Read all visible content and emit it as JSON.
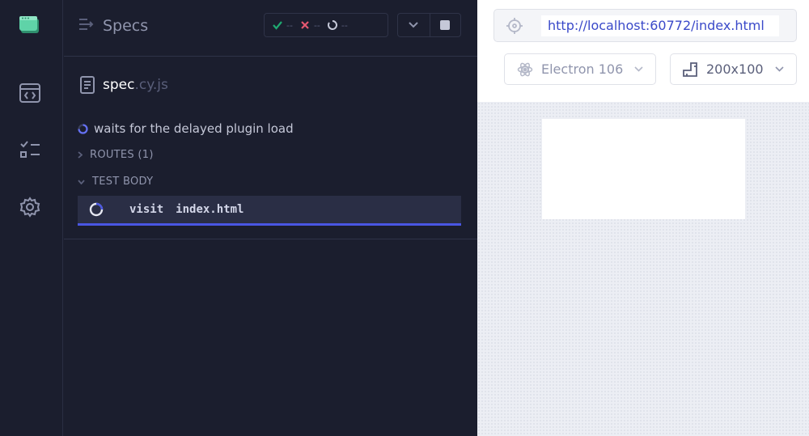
{
  "reporter": {
    "header": {
      "specs_label": "Specs",
      "stats": {
        "passed": "--",
        "failed": "--",
        "pending": "--"
      }
    },
    "spec": {
      "name": "spec",
      "ext": ".cy.js"
    },
    "test": {
      "title": "waits for the delayed plugin load",
      "routes_label": "ROUTES (1)",
      "body_label": "TEST BODY",
      "command": {
        "name": "visit",
        "arg": "index.html"
      }
    }
  },
  "aut": {
    "url": "http://localhost:60772/index.html",
    "browser": "Electron 106",
    "viewport": "200x100"
  },
  "colors": {
    "passed": "#1fa971",
    "failed": "#e45770",
    "accent": "#4956e3",
    "logo": "#5fd3a8"
  }
}
